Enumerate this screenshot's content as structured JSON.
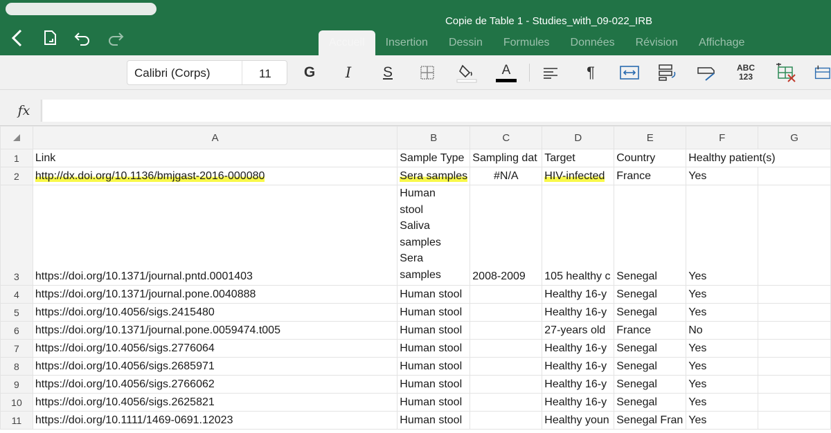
{
  "window": {
    "title": "Copie de Table 1 - Studies_with_09-022_IRB"
  },
  "tabs": [
    {
      "label": "Accueil"
    },
    {
      "label": "Insertion"
    },
    {
      "label": "Dessin"
    },
    {
      "label": "Formules"
    },
    {
      "label": "Données"
    },
    {
      "label": "Révision"
    },
    {
      "label": "Affichage"
    }
  ],
  "ribbon": {
    "font_name": "Calibri (Corps)",
    "font_size": "11",
    "bold_glyph": "G",
    "italic_glyph": "I",
    "strike_glyph": "S",
    "font_color_glyph": "A",
    "spell_glyph_top": "ABC",
    "spell_glyph_bottom": "123"
  },
  "formula_bar": {
    "fx_label": "fx",
    "value": ""
  },
  "columns": [
    "A",
    "B",
    "C",
    "D",
    "E",
    "F",
    "G"
  ],
  "rows": [
    {
      "num": "1",
      "a": "Link",
      "b": "Sample Type",
      "c": "Sampling dat",
      "d": "Target",
      "e": "Country",
      "f": "Healthy patient(s)"
    },
    {
      "num": "2",
      "a": "http://dx.doi.org/10.1136/bmjgast-2016-000080",
      "b": "Sera samples",
      "c": "#N/A",
      "d": "HIV-infected",
      "e": "France",
      "f": "Yes"
    },
    {
      "num": "3",
      "a": "https://doi.org/10.1371/journal.pntd.0001403",
      "b": "Human stool Saliva samples Sera samples",
      "c": "2008-2009",
      "d": "105 healthy c",
      "e": "Senegal",
      "f": "Yes"
    },
    {
      "num": "4",
      "a": "https://doi.org/10.1371/journal.pone.0040888",
      "b": "Human stool",
      "c": "",
      "d": "Healthy 16-y",
      "e": "Senegal",
      "f": "Yes"
    },
    {
      "num": "5",
      "a": "https://doi.org/10.4056/sigs.2415480",
      "b": "Human stool",
      "c": "",
      "d": "Healthy 16-y",
      "e": "Senegal",
      "f": "Yes"
    },
    {
      "num": "6",
      "a": "https://doi.org/10.1371/journal.pone.0059474.t005",
      "b": "Human stool",
      "c": "",
      "d": "27-years old",
      "e": "France",
      "f": "No"
    },
    {
      "num": "7",
      "a": "https://doi.org/10.4056/sigs.2776064",
      "b": "Human stool",
      "c": "",
      "d": "Healthy 16-y",
      "e": "Senegal",
      "f": "Yes"
    },
    {
      "num": "8",
      "a": "https://doi.org/10.4056/sigs.2685971",
      "b": "Human stool",
      "c": "",
      "d": "Healthy 16-y",
      "e": "Senegal",
      "f": "Yes"
    },
    {
      "num": "9",
      "a": "https://doi.org/10.4056/sigs.2766062",
      "b": "Human stool",
      "c": "",
      "d": "Healthy 16-y",
      "e": "Senegal",
      "f": "Yes"
    },
    {
      "num": "10",
      "a": "https://doi.org/10.4056/sigs.2625821",
      "b": "Human stool",
      "c": "",
      "d": "Healthy 16-y",
      "e": "Senegal",
      "f": "Yes"
    },
    {
      "num": "11",
      "a": "https://doi.org/10.1111/1469-0691.12023",
      "b": "Human stool",
      "c": "",
      "d": "Healthy youn",
      "e": "Senegal Fran",
      "f": "Yes"
    }
  ],
  "colors": {
    "header_green": "#217346",
    "highlight": "#f7f74f"
  },
  "icons": [
    "back-icon",
    "file-icon",
    "undo-icon",
    "redo-icon",
    "bold-icon",
    "italic-icon",
    "strikethrough-icon",
    "borders-icon",
    "fill-color-icon",
    "font-color-icon",
    "align-left-icon",
    "paragraph-icon",
    "wrap-icon",
    "format-icon",
    "format-painter-icon",
    "spellcheck-icon",
    "clear-icon",
    "insert-icon"
  ]
}
